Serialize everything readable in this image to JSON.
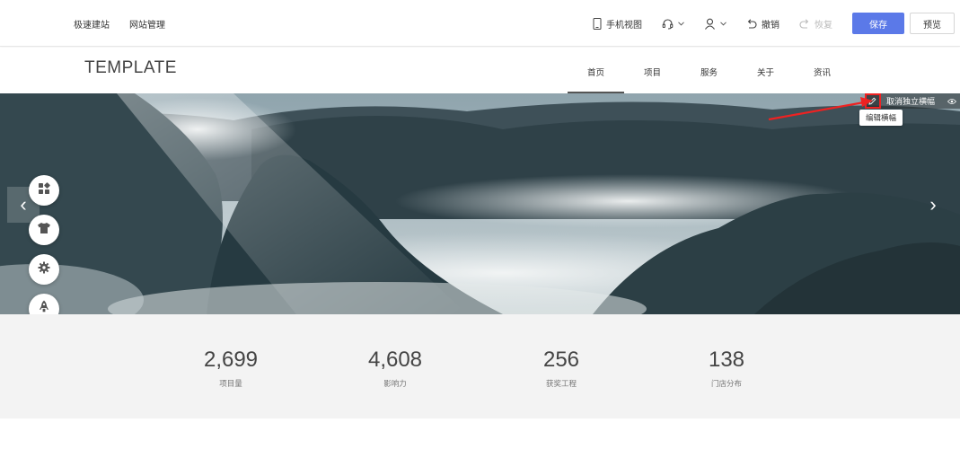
{
  "toolbar": {
    "left_links": [
      "极速建站",
      "网站管理"
    ],
    "mobile_view": "手机视图",
    "undo": "撤销",
    "redo": "恢复",
    "save": "保存",
    "preview": "预览"
  },
  "site": {
    "logo": "TEMPLATE",
    "nav": [
      "首页",
      "项目",
      "服务",
      "关于",
      "资讯"
    ]
  },
  "banner": {
    "cancel_label": "取消独立横幅",
    "tooltip": "编辑横幅",
    "prev_arrow": "‹",
    "next_arrow": "›"
  },
  "floating_tools": [
    "grid-icon",
    "shirt-icon",
    "gear-icon",
    "rocket-icon"
  ],
  "stats": [
    {
      "value": "2,699",
      "label": "项目量"
    },
    {
      "value": "4,608",
      "label": "影响力"
    },
    {
      "value": "256",
      "label": "获奖工程"
    },
    {
      "value": "138",
      "label": "门店分布"
    }
  ],
  "colors": {
    "accent": "#5b79e8",
    "highlight": "#e22222"
  }
}
